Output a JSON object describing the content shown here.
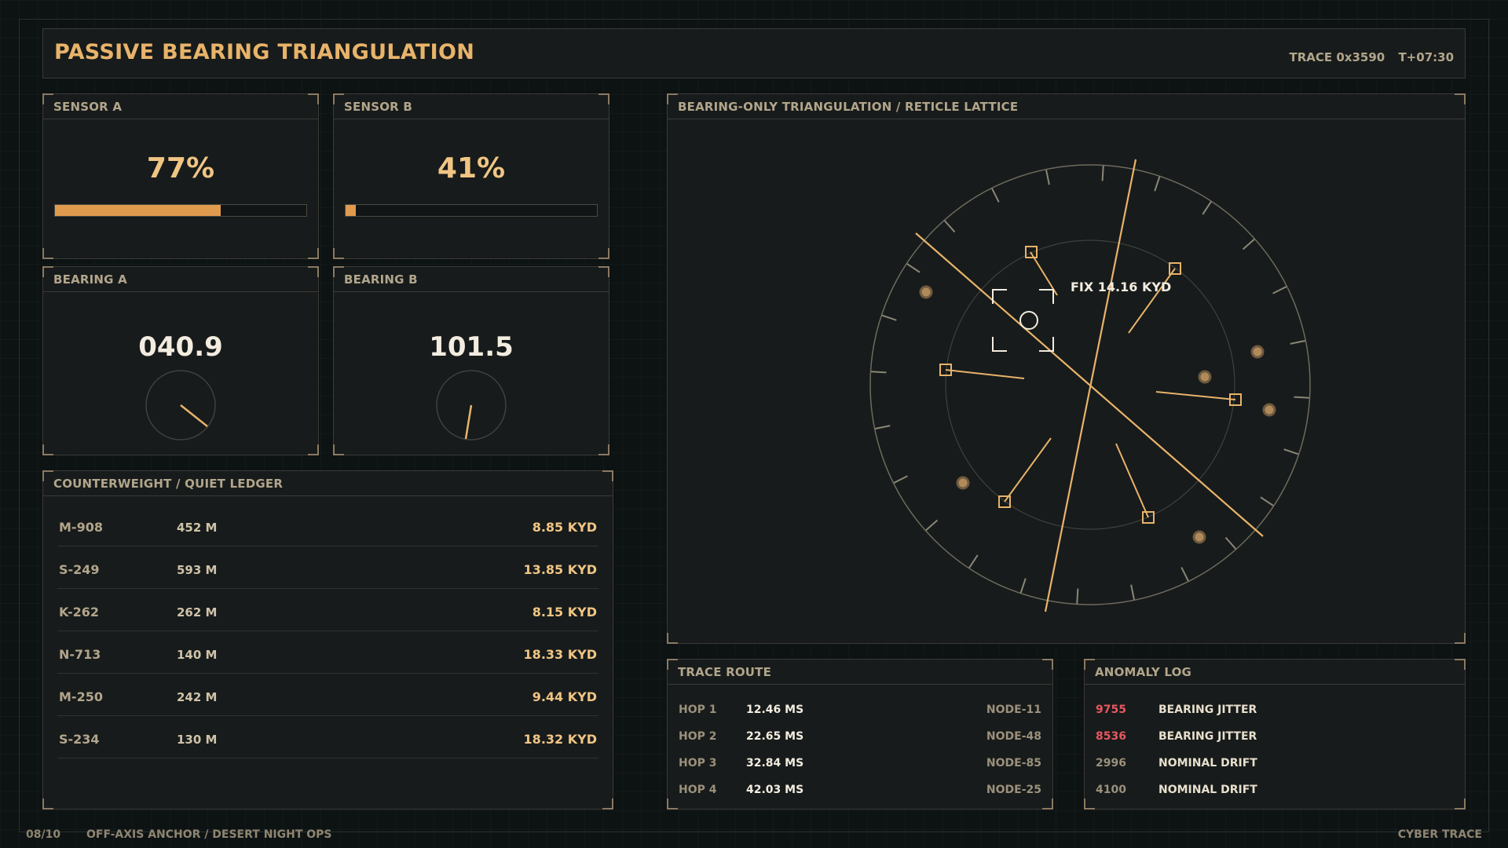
{
  "header": {
    "title": "PASSIVE BEARING TRIANGULATION",
    "trace_id": "TRACE 0x3590",
    "time": "T+07:30"
  },
  "sensor_a": {
    "label": "SENSOR A",
    "value_text": "77%",
    "level": 0.77
  },
  "sensor_b": {
    "label": "SENSOR B",
    "value_text": "41%",
    "level": 0.41
  },
  "bearing_a": {
    "label": "BEARING A",
    "value": "040.9"
  },
  "bearing_b": {
    "label": "BEARING B",
    "value": "101.5"
  },
  "ledger": {
    "title": "COUNTERWEIGHT / QUIET LEDGER",
    "rows": [
      {
        "id": "M-908",
        "dist": "452 M",
        "value": "8.85 KYD"
      },
      {
        "id": "S-249",
        "dist": "593 M",
        "value": "13.85 KYD"
      },
      {
        "id": "K-262",
        "dist": "262 M",
        "value": "8.15 KYD"
      },
      {
        "id": "N-713",
        "dist": "140 M",
        "value": "18.33 KYD"
      },
      {
        "id": "M-250",
        "dist": "242 M",
        "value": "9.44 KYD"
      },
      {
        "id": "S-234",
        "dist": "130 M",
        "value": "18.32 KYD"
      }
    ]
  },
  "triangulation": {
    "title": "BEARING-ONLY TRIANGULATION / RETICLE LATTICE",
    "fix_label": "FIX 14.16 KYD"
  },
  "trace_route": {
    "title": "TRACE ROUTE",
    "rows": [
      {
        "hop": "HOP 1",
        "latency": "12.46 MS",
        "node": "NODE-11"
      },
      {
        "hop": "HOP 2",
        "latency": "22.65 MS",
        "node": "NODE-48"
      },
      {
        "hop": "HOP 3",
        "latency": "32.84 MS",
        "node": "NODE-85"
      },
      {
        "hop": "HOP 4",
        "latency": "42.03 MS",
        "node": "NODE-25"
      }
    ]
  },
  "anomaly_log": {
    "title": "ANOMALY LOG",
    "rows": [
      {
        "code": "9755",
        "message": "BEARING JITTER",
        "severity": "alert"
      },
      {
        "code": "8536",
        "message": "BEARING JITTER",
        "severity": "alert"
      },
      {
        "code": "2996",
        "message": "NOMINAL DRIFT",
        "severity": "normal"
      },
      {
        "code": "4100",
        "message": "NOMINAL DRIFT",
        "severity": "normal"
      }
    ]
  },
  "footer": {
    "page": "08/10",
    "caption": "OFF-AXIS ANCHOR / DESERT NIGHT OPS",
    "brand": "CYBER TRACE"
  },
  "colors": {
    "accent": "#e8b36a",
    "fill": "#e09a4e",
    "alert": "#e8575f",
    "panel": "#171b1b",
    "background": "#0d1213"
  }
}
